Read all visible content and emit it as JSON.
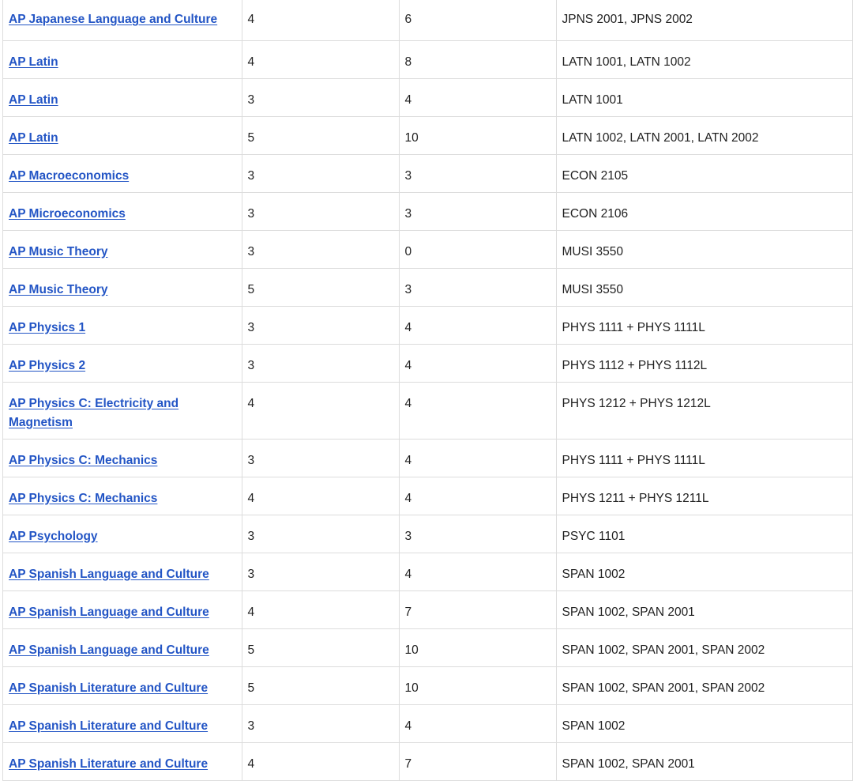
{
  "table": {
    "rows": [
      {
        "exam": "AP Japanese Language and Culture",
        "score": "4",
        "credits": "6",
        "courses": "JPNS 2001, JPNS 2002"
      },
      {
        "exam": "AP Latin",
        "score": "4",
        "credits": "8",
        "courses": "LATN 1001, LATN 1002"
      },
      {
        "exam": "AP Latin",
        "score": "3",
        "credits": "4",
        "courses": "LATN 1001"
      },
      {
        "exam": "AP Latin",
        "score": "5",
        "credits": "10",
        "courses": "LATN 1002, LATN 2001, LATN 2002"
      },
      {
        "exam": "AP Macroeconomics",
        "score": "3",
        "credits": "3",
        "courses": "ECON 2105"
      },
      {
        "exam": "AP Microeconomics",
        "score": "3",
        "credits": "3",
        "courses": "ECON 2106"
      },
      {
        "exam": "AP Music Theory",
        "score": "3",
        "credits": "0",
        "courses": "MUSI 3550"
      },
      {
        "exam": "AP Music Theory",
        "score": "5",
        "credits": "3",
        "courses": "MUSI 3550"
      },
      {
        "exam": "AP Physics 1",
        "score": "3",
        "credits": "4",
        "courses": "PHYS 1111 + PHYS 1111L"
      },
      {
        "exam": "AP Physics 2",
        "score": "3",
        "credits": "4",
        "courses": "PHYS 1112 + PHYS 1112L"
      },
      {
        "exam": "AP Physics C: Electricity and Magnetism",
        "score": "4",
        "credits": "4",
        "courses": "PHYS 1212 + PHYS 1212L"
      },
      {
        "exam": "AP Physics C: Mechanics",
        "score": "3",
        "credits": "4",
        "courses": "PHYS 1111 + PHYS 1111L"
      },
      {
        "exam": "AP Physics C: Mechanics",
        "score": "4",
        "credits": "4",
        "courses": "PHYS 1211 + PHYS 1211L"
      },
      {
        "exam": "AP Psychology",
        "score": "3",
        "credits": "3",
        "courses": "PSYC 1101"
      },
      {
        "exam": "AP Spanish Language and Culture",
        "score": "3",
        "credits": "4",
        "courses": "SPAN 1002"
      },
      {
        "exam": "AP Spanish Language and Culture",
        "score": "4",
        "credits": "7",
        "courses": "SPAN 1002, SPAN 2001"
      },
      {
        "exam": "AP Spanish Language and Culture",
        "score": "5",
        "credits": "10",
        "courses": "SPAN 1002, SPAN 2001, SPAN 2002"
      },
      {
        "exam": "AP Spanish Literature and Culture",
        "score": "5",
        "credits": "10",
        "courses": "SPAN 1002, SPAN 2001, SPAN 2002"
      },
      {
        "exam": "AP Spanish Literature and Culture",
        "score": "3",
        "credits": "4",
        "courses": "SPAN 1002"
      },
      {
        "exam": "AP Spanish Literature and Culture",
        "score": "4",
        "credits": "7",
        "courses": "SPAN 1002, SPAN 2001"
      }
    ]
  },
  "colors": {
    "link": "#2355c5",
    "text": "#212121",
    "border": "#dcdcdc"
  }
}
